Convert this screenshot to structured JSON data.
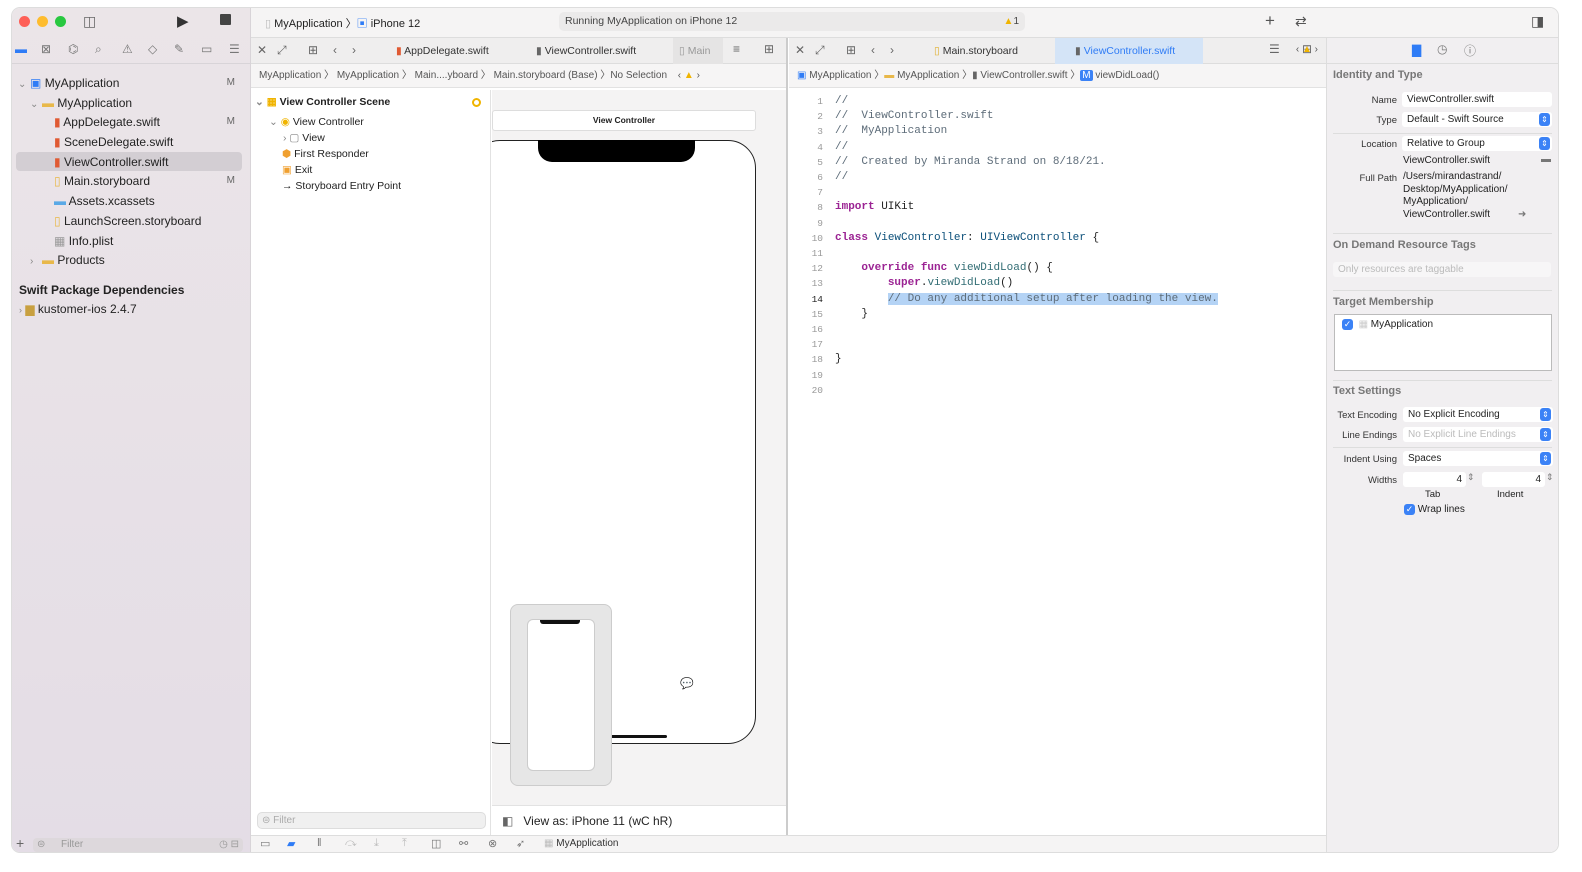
{
  "toolbar": {
    "scheme": "MyApplication",
    "device": "iPhone 12",
    "status": "Running MyApplication on iPhone 12",
    "warning_count": "1"
  },
  "navigator": {
    "items": [
      {
        "label": "MyApplication",
        "badge": "M",
        "level": 0,
        "icon": "project-icon",
        "expanded": true
      },
      {
        "label": "MyApplication",
        "badge": "",
        "level": 1,
        "icon": "folder-icon",
        "expanded": true
      },
      {
        "label": "AppDelegate.swift",
        "badge": "M",
        "level": 2,
        "icon": "swift-file-icon"
      },
      {
        "label": "SceneDelegate.swift",
        "badge": "",
        "level": 2,
        "icon": "swift-file-icon"
      },
      {
        "label": "ViewController.swift",
        "badge": "",
        "level": 2,
        "icon": "swift-file-icon",
        "selected": true
      },
      {
        "label": "Main.storyboard",
        "badge": "M",
        "level": 2,
        "icon": "storyboard-icon"
      },
      {
        "label": "Assets.xcassets",
        "badge": "",
        "level": 2,
        "icon": "assets-icon"
      },
      {
        "label": "LaunchScreen.storyboard",
        "badge": "",
        "level": 2,
        "icon": "storyboard-icon"
      },
      {
        "label": "Info.plist",
        "badge": "",
        "level": 2,
        "icon": "plist-icon"
      },
      {
        "label": "Products",
        "badge": "",
        "level": 1,
        "icon": "folder-icon",
        "expanded": false
      }
    ],
    "packages_header": "Swift Package Dependencies",
    "package": "kustomer-ios 2.4.7",
    "filter_placeholder": "Filter"
  },
  "left_editor": {
    "tabs": [
      "AppDelegate.swift",
      "ViewController.swift",
      "Main"
    ],
    "jump": [
      "MyApplication",
      "MyApplication",
      "Main....yboard",
      "Main.storyboard (Base)",
      "No Selection"
    ],
    "outline": {
      "scene": "View Controller Scene",
      "vc": "View Controller",
      "view": "View",
      "first_responder": "First Responder",
      "exit": "Exit",
      "entry": "Storyboard Entry Point"
    },
    "outline_filter": "Filter",
    "canvas_title": "View Controller",
    "view_as": "View as: iPhone 11 (wC hR)"
  },
  "right_editor": {
    "tabs": [
      "Main.storyboard",
      "ViewController.swift"
    ],
    "jump": [
      "MyApplication",
      "MyApplication",
      "ViewController.swift",
      "viewDidLoad()"
    ],
    "current_line": "14",
    "lines": [
      "//",
      "//  ViewController.swift",
      "//  MyApplication",
      "//",
      "//  Created by Miranda Strand on 8/18/21.",
      "//",
      "",
      "import UIKit",
      "",
      "class ViewController: UIViewController {",
      "",
      "    override func viewDidLoad() {",
      "        super.viewDidLoad()",
      "        // Do any additional setup after loading the view.",
      "    }",
      "",
      "",
      "}",
      "",
      ""
    ]
  },
  "inspector": {
    "identity_header": "Identity and Type",
    "name_label": "Name",
    "name": "ViewController.swift",
    "type_label": "Type",
    "type": "Default - Swift Source",
    "location_label": "Location",
    "location": "Relative to Group",
    "location_file": "ViewController.swift",
    "fullpath_label": "Full Path",
    "fullpath": [
      "/Users/mirandastrand/",
      "Desktop/MyApplication/",
      "MyApplication/",
      "ViewController.swift"
    ],
    "odr_header": "On Demand Resource Tags",
    "odr_placeholder": "Only resources are taggable",
    "target_header": "Target Membership",
    "target": "MyApplication",
    "text_header": "Text Settings",
    "encoding_label": "Text Encoding",
    "encoding": "No Explicit Encoding",
    "endings_label": "Line Endings",
    "endings": "No Explicit Line Endings",
    "indent_label": "Indent Using",
    "indent": "Spaces",
    "widths_label": "Widths",
    "tab_width": "4",
    "indent_width": "4",
    "tab_label": "Tab",
    "indent_sub_label": "Indent",
    "wrap_label": "Wrap lines"
  },
  "debug_bar": {
    "target": "MyApplication"
  }
}
